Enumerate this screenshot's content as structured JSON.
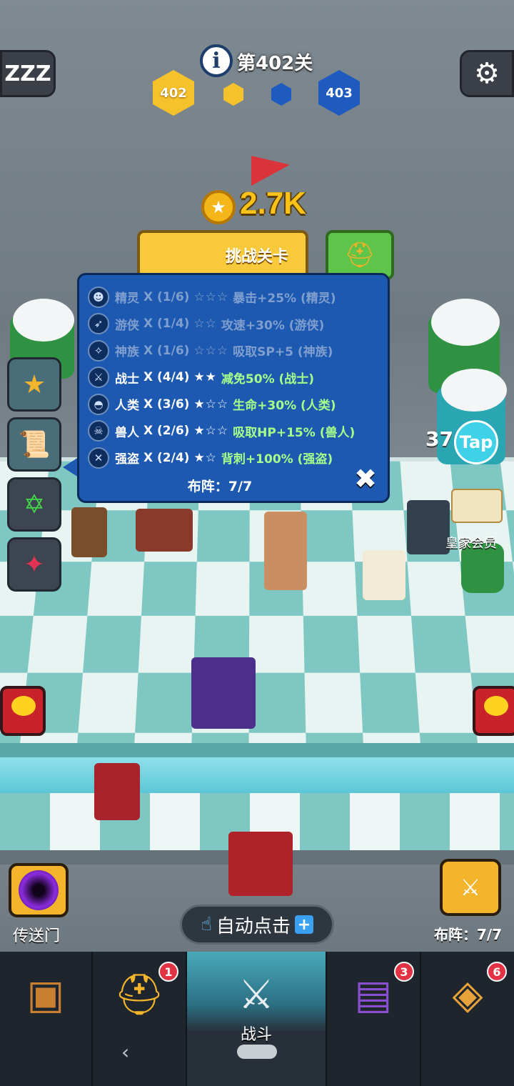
{
  "hud": {
    "sleep_icon_text": "ZZZ",
    "level_title": "第402关",
    "current_stage": "402",
    "next_stage": "403"
  },
  "challenge": {
    "coins": "2.7K",
    "button_label": "挑战关卡"
  },
  "synergy_panel": {
    "rows": [
      {
        "icon": "elf-icon",
        "glyph": "☻",
        "name": "精灵",
        "count": "X (1/6)",
        "stars": "☆☆☆",
        "bonus": "暴击+25% (精灵)",
        "active": false
      },
      {
        "icon": "bow-icon",
        "glyph": "➶",
        "name": "游侠",
        "count": "X (1/4)",
        "stars": "☆☆",
        "bonus": "攻速+30% (游侠)",
        "active": false
      },
      {
        "icon": "wings-icon",
        "glyph": "✧",
        "name": "神族",
        "count": "X (1/6)",
        "stars": "☆☆☆",
        "bonus": "吸取SP+5 (神族)",
        "active": false
      },
      {
        "icon": "sword-icon",
        "glyph": "⚔",
        "name": "战士",
        "count": "X (4/4)",
        "stars": "★★",
        "bonus": "减免50% (战士)",
        "active": true
      },
      {
        "icon": "helmet-icon",
        "glyph": "◓",
        "name": "人类",
        "count": "X (3/6)",
        "stars": "★☆☆",
        "bonus": "生命+30% (人类)",
        "active": true
      },
      {
        "icon": "orc-icon",
        "glyph": "☠",
        "name": "兽人",
        "count": "X (2/6)",
        "stars": "★☆☆",
        "bonus": "吸取HP+15% (兽人)",
        "active": true
      },
      {
        "icon": "dagger-icon",
        "glyph": "✕",
        "name": "强盗",
        "count": "X (2/4)",
        "stars": "★☆",
        "bonus": "背刺+100% (强盗)",
        "active": true
      }
    ],
    "footer": "布阵：7/7"
  },
  "right_side": {
    "tap_count": "37",
    "tap_label": "Tap",
    "royal_label": "皇家会员"
  },
  "bottom": {
    "portal_label": "传送门",
    "auto_click_label": "自动点击",
    "formation_label": "布阵：7/7"
  },
  "nav": {
    "items": [
      {
        "name": "chest",
        "badge": "",
        "label": ""
      },
      {
        "name": "heroes",
        "badge": "1",
        "label": ""
      },
      {
        "name": "battle",
        "badge": "",
        "label": "战斗"
      },
      {
        "name": "spellbook",
        "badge": "3",
        "label": ""
      },
      {
        "name": "amulet",
        "badge": "6",
        "label": ""
      }
    ]
  },
  "colors": {
    "panel_bg": "#1d59b0",
    "gold": "#f6c22b",
    "blue_hex": "#1f5bbf",
    "active_bonus": "#a8ff8a"
  }
}
